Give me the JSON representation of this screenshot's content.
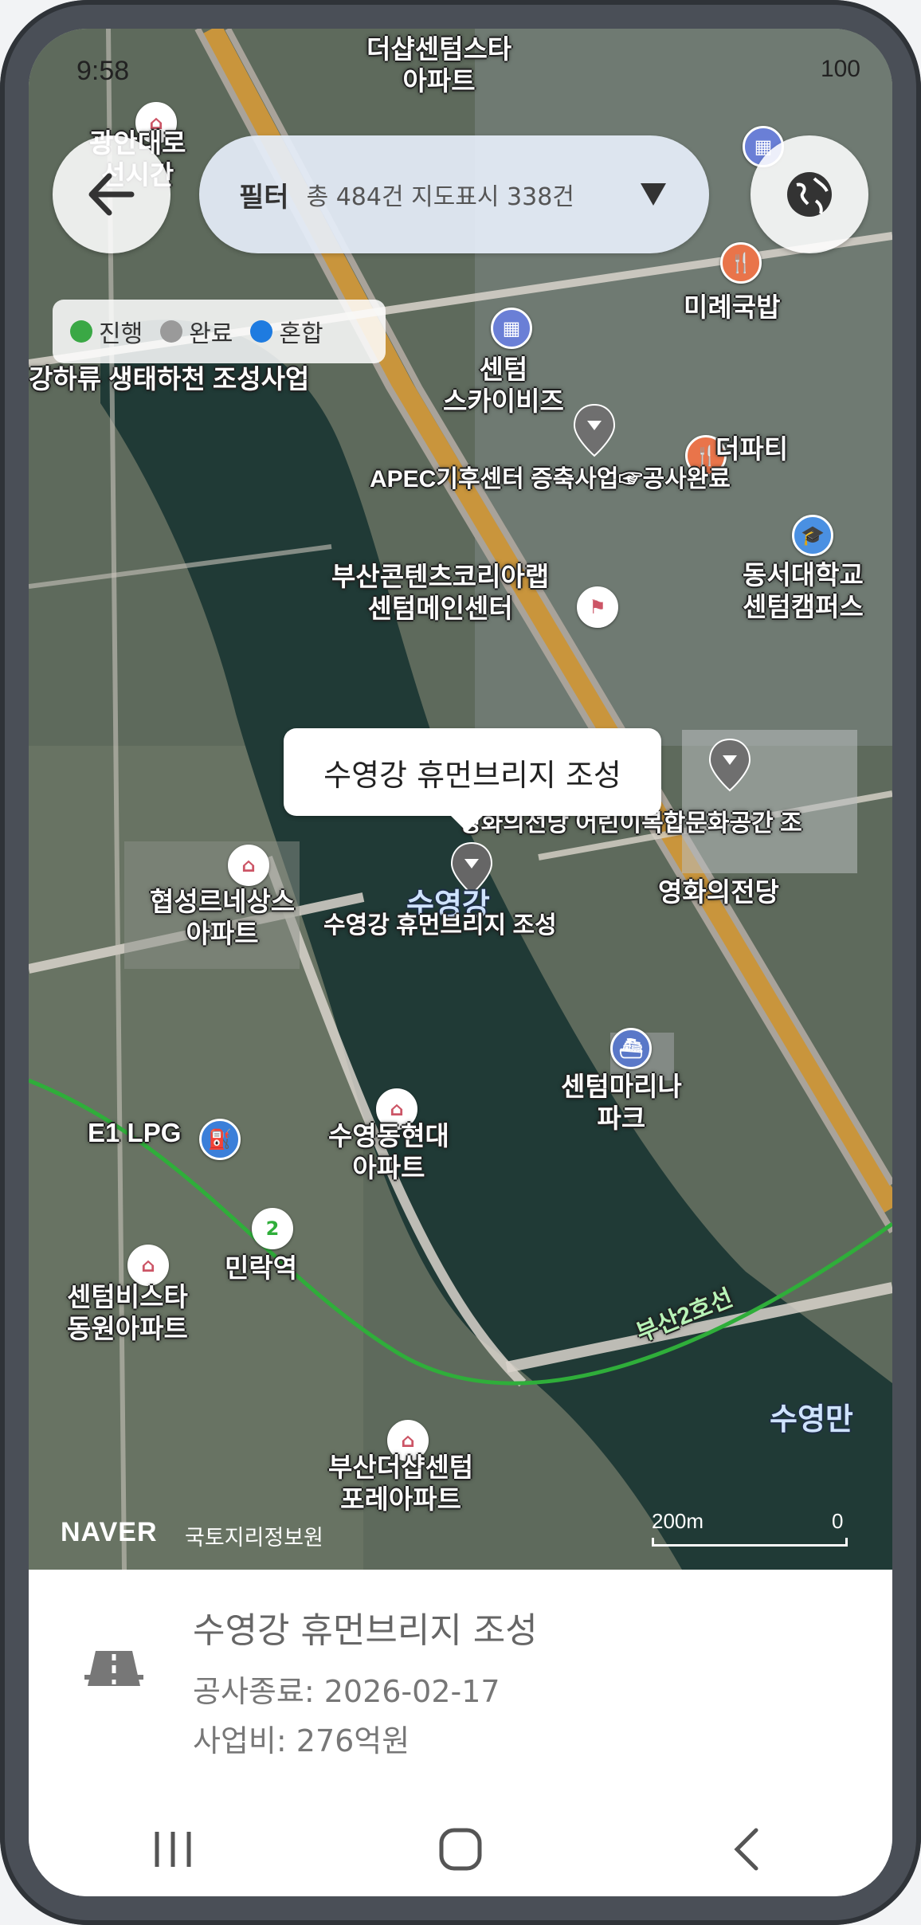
{
  "status_bar": {
    "time": "9:58",
    "battery": "100"
  },
  "top_controls": {
    "filter_title": "필터",
    "filter_stats": "총 484건 지도표시 338건"
  },
  "legend": [
    {
      "label": "진행",
      "color": "#3aa845"
    },
    {
      "label": "완료",
      "color": "#9a9a9a"
    },
    {
      "label": "혼합",
      "color": "#1e7be0"
    }
  ],
  "map_labels": {
    "apt_thesharp": "더샵센텀스타\n아파트",
    "gwangan": "광안대로\n선시간",
    "river_project": "강하류 생태하천 조성사업",
    "centum_skybiz": "센텀\n스카이비즈",
    "apec_project": "APEC기후센터 증축사업☞공사완료",
    "partyy": "더파티",
    "mireguk": "미례국밥",
    "content_lab": "부산콘텐츠코리아랩\n센텀메인센터",
    "dongseo_univ": "동서대학교\n센텀캠퍼스",
    "cinema_project": "영화의전당 어린이복합문화공간 조",
    "cinema": "영화의전당",
    "hyeopseong": "협성르네상스\n아파트",
    "suyeonggang": "수영강",
    "human_bridge_map": "수영강 휴먼브리지 조성",
    "marina": "센텀마리나\n파크",
    "e1lpg": "E1 LPG",
    "hyundai_apt": "수영동현대\n아파트",
    "minrak": "민락역",
    "bista": "센텀비스타\n동원아파트",
    "busan_line2": "부산2호선",
    "suyeongman": "수영만",
    "thesharp_forest": "부산더샵센텀\n포레아파트",
    "station_num": "2"
  },
  "callout": {
    "text": "수영강 휴먼브리지 조성"
  },
  "map_footer": {
    "brand": "NAVER",
    "source": "국토지리정보원",
    "scale_left": "200m",
    "scale_right": "0"
  },
  "bottom_sheet": {
    "title": "수영강 휴먼브리지 조성",
    "end_date": "공사종료: 2026-02-17",
    "budget": "사업비: 276억원"
  }
}
